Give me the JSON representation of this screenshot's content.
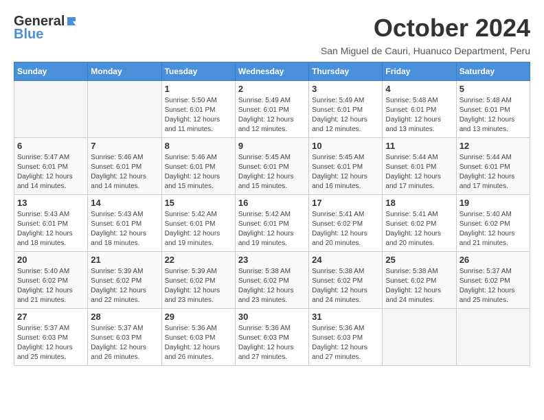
{
  "logo": {
    "general": "General",
    "blue": "Blue"
  },
  "title": "October 2024",
  "location": "San Miguel de Cauri, Huanuco Department, Peru",
  "days_of_week": [
    "Sunday",
    "Monday",
    "Tuesday",
    "Wednesday",
    "Thursday",
    "Friday",
    "Saturday"
  ],
  "weeks": [
    [
      {
        "day": "",
        "info": ""
      },
      {
        "day": "",
        "info": ""
      },
      {
        "day": "1",
        "info": "Sunrise: 5:50 AM\nSunset: 6:01 PM\nDaylight: 12 hours and 11 minutes."
      },
      {
        "day": "2",
        "info": "Sunrise: 5:49 AM\nSunset: 6:01 PM\nDaylight: 12 hours and 12 minutes."
      },
      {
        "day": "3",
        "info": "Sunrise: 5:49 AM\nSunset: 6:01 PM\nDaylight: 12 hours and 12 minutes."
      },
      {
        "day": "4",
        "info": "Sunrise: 5:48 AM\nSunset: 6:01 PM\nDaylight: 12 hours and 13 minutes."
      },
      {
        "day": "5",
        "info": "Sunrise: 5:48 AM\nSunset: 6:01 PM\nDaylight: 12 hours and 13 minutes."
      }
    ],
    [
      {
        "day": "6",
        "info": "Sunrise: 5:47 AM\nSunset: 6:01 PM\nDaylight: 12 hours and 14 minutes."
      },
      {
        "day": "7",
        "info": "Sunrise: 5:46 AM\nSunset: 6:01 PM\nDaylight: 12 hours and 14 minutes."
      },
      {
        "day": "8",
        "info": "Sunrise: 5:46 AM\nSunset: 6:01 PM\nDaylight: 12 hours and 15 minutes."
      },
      {
        "day": "9",
        "info": "Sunrise: 5:45 AM\nSunset: 6:01 PM\nDaylight: 12 hours and 15 minutes."
      },
      {
        "day": "10",
        "info": "Sunrise: 5:45 AM\nSunset: 6:01 PM\nDaylight: 12 hours and 16 minutes."
      },
      {
        "day": "11",
        "info": "Sunrise: 5:44 AM\nSunset: 6:01 PM\nDaylight: 12 hours and 17 minutes."
      },
      {
        "day": "12",
        "info": "Sunrise: 5:44 AM\nSunset: 6:01 PM\nDaylight: 12 hours and 17 minutes."
      }
    ],
    [
      {
        "day": "13",
        "info": "Sunrise: 5:43 AM\nSunset: 6:01 PM\nDaylight: 12 hours and 18 minutes."
      },
      {
        "day": "14",
        "info": "Sunrise: 5:43 AM\nSunset: 6:01 PM\nDaylight: 12 hours and 18 minutes."
      },
      {
        "day": "15",
        "info": "Sunrise: 5:42 AM\nSunset: 6:01 PM\nDaylight: 12 hours and 19 minutes."
      },
      {
        "day": "16",
        "info": "Sunrise: 5:42 AM\nSunset: 6:01 PM\nDaylight: 12 hours and 19 minutes."
      },
      {
        "day": "17",
        "info": "Sunrise: 5:41 AM\nSunset: 6:02 PM\nDaylight: 12 hours and 20 minutes."
      },
      {
        "day": "18",
        "info": "Sunrise: 5:41 AM\nSunset: 6:02 PM\nDaylight: 12 hours and 20 minutes."
      },
      {
        "day": "19",
        "info": "Sunrise: 5:40 AM\nSunset: 6:02 PM\nDaylight: 12 hours and 21 minutes."
      }
    ],
    [
      {
        "day": "20",
        "info": "Sunrise: 5:40 AM\nSunset: 6:02 PM\nDaylight: 12 hours and 21 minutes."
      },
      {
        "day": "21",
        "info": "Sunrise: 5:39 AM\nSunset: 6:02 PM\nDaylight: 12 hours and 22 minutes."
      },
      {
        "day": "22",
        "info": "Sunrise: 5:39 AM\nSunset: 6:02 PM\nDaylight: 12 hours and 23 minutes."
      },
      {
        "day": "23",
        "info": "Sunrise: 5:38 AM\nSunset: 6:02 PM\nDaylight: 12 hours and 23 minutes."
      },
      {
        "day": "24",
        "info": "Sunrise: 5:38 AM\nSunset: 6:02 PM\nDaylight: 12 hours and 24 minutes."
      },
      {
        "day": "25",
        "info": "Sunrise: 5:38 AM\nSunset: 6:02 PM\nDaylight: 12 hours and 24 minutes."
      },
      {
        "day": "26",
        "info": "Sunrise: 5:37 AM\nSunset: 6:02 PM\nDaylight: 12 hours and 25 minutes."
      }
    ],
    [
      {
        "day": "27",
        "info": "Sunrise: 5:37 AM\nSunset: 6:03 PM\nDaylight: 12 hours and 25 minutes."
      },
      {
        "day": "28",
        "info": "Sunrise: 5:37 AM\nSunset: 6:03 PM\nDaylight: 12 hours and 26 minutes."
      },
      {
        "day": "29",
        "info": "Sunrise: 5:36 AM\nSunset: 6:03 PM\nDaylight: 12 hours and 26 minutes."
      },
      {
        "day": "30",
        "info": "Sunrise: 5:36 AM\nSunset: 6:03 PM\nDaylight: 12 hours and 27 minutes."
      },
      {
        "day": "31",
        "info": "Sunrise: 5:36 AM\nSunset: 6:03 PM\nDaylight: 12 hours and 27 minutes."
      },
      {
        "day": "",
        "info": ""
      },
      {
        "day": "",
        "info": ""
      }
    ]
  ]
}
